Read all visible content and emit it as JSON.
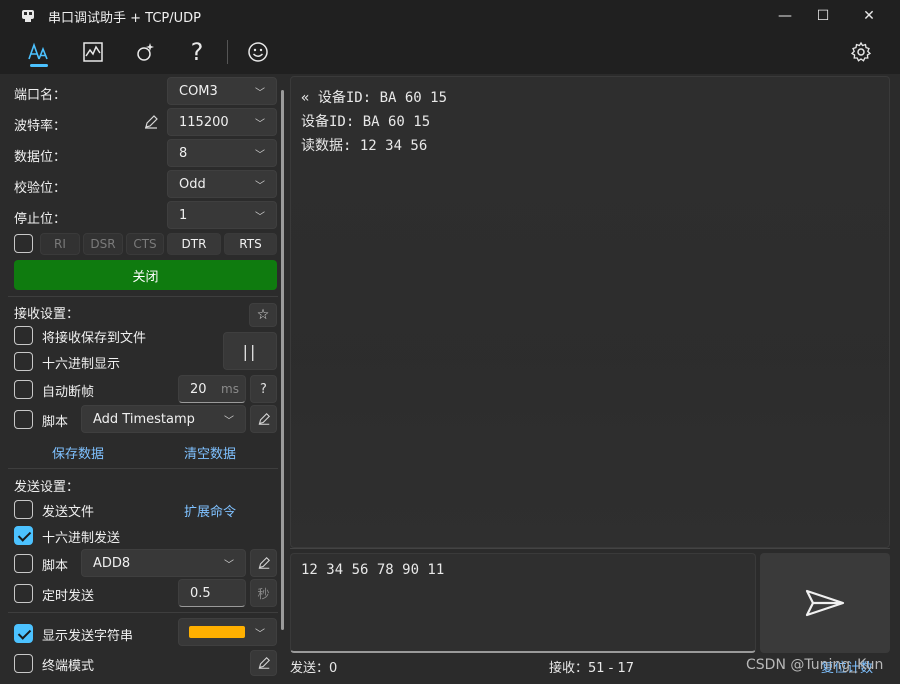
{
  "window": {
    "title": "串口调试助手 + TCP/UDP",
    "minimize": "—",
    "maximize": "☐",
    "close": "✕"
  },
  "toolbar": {
    "icons": [
      "text-style-icon",
      "chart-icon",
      "effects-icon",
      "help-icon",
      "smiley-icon",
      "settings-icon"
    ],
    "help_glyph": "?",
    "accent": "#4cc2ff"
  },
  "serial": {
    "port_label": "端口名：",
    "port_value": "COM3",
    "baud_label": "波特率：",
    "baud_value": "115200",
    "databits_label": "数据位：",
    "databits_value": "8",
    "parity_label": "校验位：",
    "parity_value": "Odd",
    "stopbits_label": "停止位：",
    "stopbits_value": "1",
    "pins": [
      "RI",
      "DSR",
      "CTS",
      "DTR",
      "RTS"
    ],
    "close_button": "关闭",
    "close_button_color": "#0f7b0f"
  },
  "receive": {
    "section_label": "接收设置：",
    "save_to_file": "将接收保存到文件",
    "hex_display": "十六进制显示",
    "auto_frame": "自动断帧",
    "auto_frame_value": "20",
    "auto_frame_unit": "ms",
    "auto_frame_help": "?",
    "script_label": "脚本",
    "script_value": "Add Timestamp",
    "save_data": "保存数据",
    "clear_data": "清空数据",
    "pause_glyph": "||",
    "star_glyph": "☆",
    "lines": [
      "« 设备ID: BA 60 15",
      "设备ID: BA 60 15",
      "读数据: 12 34 56"
    ]
  },
  "send": {
    "section_label": "发送设置：",
    "send_file": "发送文件",
    "extend_cmd": "扩展命令",
    "hex_send": "十六进制发送",
    "script_label": "脚本",
    "script_value": "ADD8",
    "timed_send": "定时发送",
    "timed_value": "0.5",
    "timed_unit": "秒",
    "show_send": "显示发送字符串",
    "show_send_color": "#ffb000",
    "terminal_mode": "终端模式",
    "input_text": "12 34 56 78 90 11"
  },
  "status": {
    "sent": "发送：0",
    "received": "接收：51 - 17",
    "reset_count": "复位计数",
    "watermark": "CSDN @Tuning_Kun"
  }
}
